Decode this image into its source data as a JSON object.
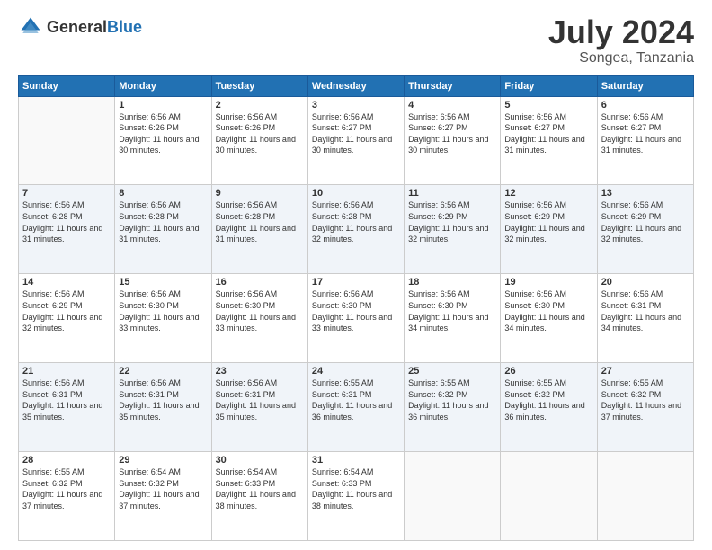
{
  "logo": {
    "general": "General",
    "blue": "Blue"
  },
  "header": {
    "month": "July 2024",
    "location": "Songea, Tanzania"
  },
  "weekdays": [
    "Sunday",
    "Monday",
    "Tuesday",
    "Wednesday",
    "Thursday",
    "Friday",
    "Saturday"
  ],
  "rows": [
    [
      {
        "day": "",
        "sunrise": "",
        "sunset": "",
        "daylight": ""
      },
      {
        "day": "1",
        "sunrise": "Sunrise: 6:56 AM",
        "sunset": "Sunset: 6:26 PM",
        "daylight": "Daylight: 11 hours and 30 minutes."
      },
      {
        "day": "2",
        "sunrise": "Sunrise: 6:56 AM",
        "sunset": "Sunset: 6:26 PM",
        "daylight": "Daylight: 11 hours and 30 minutes."
      },
      {
        "day": "3",
        "sunrise": "Sunrise: 6:56 AM",
        "sunset": "Sunset: 6:27 PM",
        "daylight": "Daylight: 11 hours and 30 minutes."
      },
      {
        "day": "4",
        "sunrise": "Sunrise: 6:56 AM",
        "sunset": "Sunset: 6:27 PM",
        "daylight": "Daylight: 11 hours and 30 minutes."
      },
      {
        "day": "5",
        "sunrise": "Sunrise: 6:56 AM",
        "sunset": "Sunset: 6:27 PM",
        "daylight": "Daylight: 11 hours and 31 minutes."
      },
      {
        "day": "6",
        "sunrise": "Sunrise: 6:56 AM",
        "sunset": "Sunset: 6:27 PM",
        "daylight": "Daylight: 11 hours and 31 minutes."
      }
    ],
    [
      {
        "day": "7",
        "sunrise": "Sunrise: 6:56 AM",
        "sunset": "Sunset: 6:28 PM",
        "daylight": "Daylight: 11 hours and 31 minutes."
      },
      {
        "day": "8",
        "sunrise": "Sunrise: 6:56 AM",
        "sunset": "Sunset: 6:28 PM",
        "daylight": "Daylight: 11 hours and 31 minutes."
      },
      {
        "day": "9",
        "sunrise": "Sunrise: 6:56 AM",
        "sunset": "Sunset: 6:28 PM",
        "daylight": "Daylight: 11 hours and 31 minutes."
      },
      {
        "day": "10",
        "sunrise": "Sunrise: 6:56 AM",
        "sunset": "Sunset: 6:28 PM",
        "daylight": "Daylight: 11 hours and 32 minutes."
      },
      {
        "day": "11",
        "sunrise": "Sunrise: 6:56 AM",
        "sunset": "Sunset: 6:29 PM",
        "daylight": "Daylight: 11 hours and 32 minutes."
      },
      {
        "day": "12",
        "sunrise": "Sunrise: 6:56 AM",
        "sunset": "Sunset: 6:29 PM",
        "daylight": "Daylight: 11 hours and 32 minutes."
      },
      {
        "day": "13",
        "sunrise": "Sunrise: 6:56 AM",
        "sunset": "Sunset: 6:29 PM",
        "daylight": "Daylight: 11 hours and 32 minutes."
      }
    ],
    [
      {
        "day": "14",
        "sunrise": "Sunrise: 6:56 AM",
        "sunset": "Sunset: 6:29 PM",
        "daylight": "Daylight: 11 hours and 32 minutes."
      },
      {
        "day": "15",
        "sunrise": "Sunrise: 6:56 AM",
        "sunset": "Sunset: 6:30 PM",
        "daylight": "Daylight: 11 hours and 33 minutes."
      },
      {
        "day": "16",
        "sunrise": "Sunrise: 6:56 AM",
        "sunset": "Sunset: 6:30 PM",
        "daylight": "Daylight: 11 hours and 33 minutes."
      },
      {
        "day": "17",
        "sunrise": "Sunrise: 6:56 AM",
        "sunset": "Sunset: 6:30 PM",
        "daylight": "Daylight: 11 hours and 33 minutes."
      },
      {
        "day": "18",
        "sunrise": "Sunrise: 6:56 AM",
        "sunset": "Sunset: 6:30 PM",
        "daylight": "Daylight: 11 hours and 34 minutes."
      },
      {
        "day": "19",
        "sunrise": "Sunrise: 6:56 AM",
        "sunset": "Sunset: 6:30 PM",
        "daylight": "Daylight: 11 hours and 34 minutes."
      },
      {
        "day": "20",
        "sunrise": "Sunrise: 6:56 AM",
        "sunset": "Sunset: 6:31 PM",
        "daylight": "Daylight: 11 hours and 34 minutes."
      }
    ],
    [
      {
        "day": "21",
        "sunrise": "Sunrise: 6:56 AM",
        "sunset": "Sunset: 6:31 PM",
        "daylight": "Daylight: 11 hours and 35 minutes."
      },
      {
        "day": "22",
        "sunrise": "Sunrise: 6:56 AM",
        "sunset": "Sunset: 6:31 PM",
        "daylight": "Daylight: 11 hours and 35 minutes."
      },
      {
        "day": "23",
        "sunrise": "Sunrise: 6:56 AM",
        "sunset": "Sunset: 6:31 PM",
        "daylight": "Daylight: 11 hours and 35 minutes."
      },
      {
        "day": "24",
        "sunrise": "Sunrise: 6:55 AM",
        "sunset": "Sunset: 6:31 PM",
        "daylight": "Daylight: 11 hours and 36 minutes."
      },
      {
        "day": "25",
        "sunrise": "Sunrise: 6:55 AM",
        "sunset": "Sunset: 6:32 PM",
        "daylight": "Daylight: 11 hours and 36 minutes."
      },
      {
        "day": "26",
        "sunrise": "Sunrise: 6:55 AM",
        "sunset": "Sunset: 6:32 PM",
        "daylight": "Daylight: 11 hours and 36 minutes."
      },
      {
        "day": "27",
        "sunrise": "Sunrise: 6:55 AM",
        "sunset": "Sunset: 6:32 PM",
        "daylight": "Daylight: 11 hours and 37 minutes."
      }
    ],
    [
      {
        "day": "28",
        "sunrise": "Sunrise: 6:55 AM",
        "sunset": "Sunset: 6:32 PM",
        "daylight": "Daylight: 11 hours and 37 minutes."
      },
      {
        "day": "29",
        "sunrise": "Sunrise: 6:54 AM",
        "sunset": "Sunset: 6:32 PM",
        "daylight": "Daylight: 11 hours and 37 minutes."
      },
      {
        "day": "30",
        "sunrise": "Sunrise: 6:54 AM",
        "sunset": "Sunset: 6:33 PM",
        "daylight": "Daylight: 11 hours and 38 minutes."
      },
      {
        "day": "31",
        "sunrise": "Sunrise: 6:54 AM",
        "sunset": "Sunset: 6:33 PM",
        "daylight": "Daylight: 11 hours and 38 minutes."
      },
      {
        "day": "",
        "sunrise": "",
        "sunset": "",
        "daylight": ""
      },
      {
        "day": "",
        "sunrise": "",
        "sunset": "",
        "daylight": ""
      },
      {
        "day": "",
        "sunrise": "",
        "sunset": "",
        "daylight": ""
      }
    ]
  ]
}
